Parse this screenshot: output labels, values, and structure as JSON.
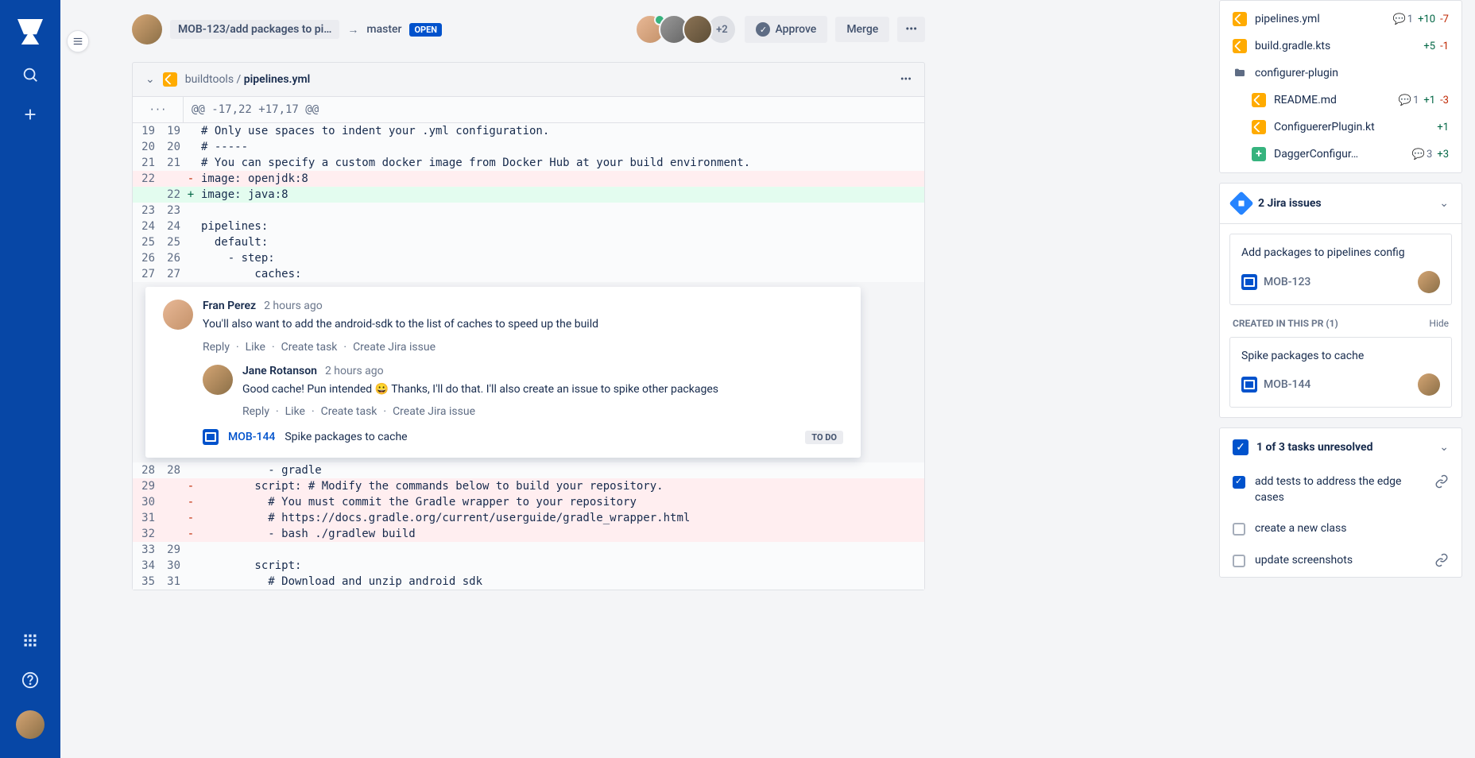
{
  "branch": {
    "source": "MOB-123/add packages to pi…",
    "target": "master",
    "status": "OPEN"
  },
  "topbar": {
    "extra_reviewers": "+2",
    "approve": "Approve",
    "merge": "Merge"
  },
  "file": {
    "path_prefix": "buildtools / ",
    "name": "pipelines.yml",
    "hunk": "@@ -17,22 +17,17 @@"
  },
  "diff": {
    "l1": {
      "old": "19",
      "new": "19",
      "code": "# Only use spaces to indent your .yml configuration."
    },
    "l2": {
      "old": "20",
      "new": "20",
      "code": "# -----"
    },
    "l3": {
      "old": "21",
      "new": "21",
      "code": "# You can specify a custom docker image from Docker Hub at your build environment."
    },
    "l4": {
      "old": "22",
      "new": "",
      "code": "image: openjdk:8"
    },
    "l5": {
      "old": "",
      "new": "22",
      "code": "image: java:8"
    },
    "l6": {
      "old": "23",
      "new": "23",
      "code": ""
    },
    "l7": {
      "old": "24",
      "new": "24",
      "code": "pipelines:"
    },
    "l8": {
      "old": "25",
      "new": "25",
      "code": "  default:"
    },
    "l9": {
      "old": "26",
      "new": "26",
      "code": "    - step:"
    },
    "l10": {
      "old": "27",
      "new": "27",
      "code": "        caches:"
    },
    "l11": {
      "old": "28",
      "new": "28",
      "code": "          - gradle"
    },
    "l12": {
      "old": "29",
      "new": "",
      "code": "        script: # Modify the commands below to build your repository."
    },
    "l13": {
      "old": "30",
      "new": "",
      "code": "          # You must commit the Gradle wrapper to your repository"
    },
    "l14": {
      "old": "31",
      "new": "",
      "code": "          # https://docs.gradle.org/current/userguide/gradle_wrapper.html"
    },
    "l15": {
      "old": "32",
      "new": "",
      "code": "          - bash ./gradlew build"
    },
    "l16": {
      "old": "33",
      "new": "29",
      "code": ""
    },
    "l17": {
      "old": "34",
      "new": "30",
      "code": "        script:"
    },
    "l18": {
      "old": "35",
      "new": "31",
      "code": "          # Download and unzip android sdk"
    }
  },
  "comments": {
    "c1": {
      "author": "Fran Perez",
      "time": "2 hours ago",
      "text": "You'll also want to add the android-sdk to the list of caches to speed up the build"
    },
    "c2": {
      "author": "Jane Rotanson",
      "time": "2 hours ago",
      "text": "Good cache! Pun intended 😀 Thanks, I'll do that. I'll also create an issue to spike other packages"
    },
    "actions": {
      "reply": "Reply",
      "like": "Like",
      "task": "Create task",
      "jira": "Create Jira issue"
    },
    "linked": {
      "key": "MOB-144",
      "summary": "Spike packages to cache",
      "status": "TO DO"
    }
  },
  "tree": {
    "f1": {
      "name": "pipelines.yml",
      "comments": "1",
      "plus": "+10",
      "minus": "-7"
    },
    "f2": {
      "name": "build.gradle.kts",
      "plus": "+5",
      "minus": "-1"
    },
    "folder": "configurer-plugin",
    "f3": {
      "name": "README.md",
      "comments": "1",
      "plus": "+1",
      "minus": "-3"
    },
    "f4": {
      "name": "ConfiguererPlugin.kt",
      "plus": "+1"
    },
    "f5": {
      "name": "DaggerConfigur…",
      "comments": "3",
      "plus": "+3"
    }
  },
  "jira_panel": {
    "title": "2 Jira issues",
    "i1": {
      "summary": "Add packages to pipelines config",
      "key": "MOB-123"
    },
    "subheader": "CREATED IN THIS PR (1)",
    "hide": "Hide",
    "i2": {
      "summary": "Spike packages to cache",
      "key": "MOB-144"
    }
  },
  "tasks_panel": {
    "title": "1 of 3 tasks unresolved",
    "t1": "add tests to address the edge cases",
    "t2": "create a new class",
    "t3": "update screenshots"
  }
}
